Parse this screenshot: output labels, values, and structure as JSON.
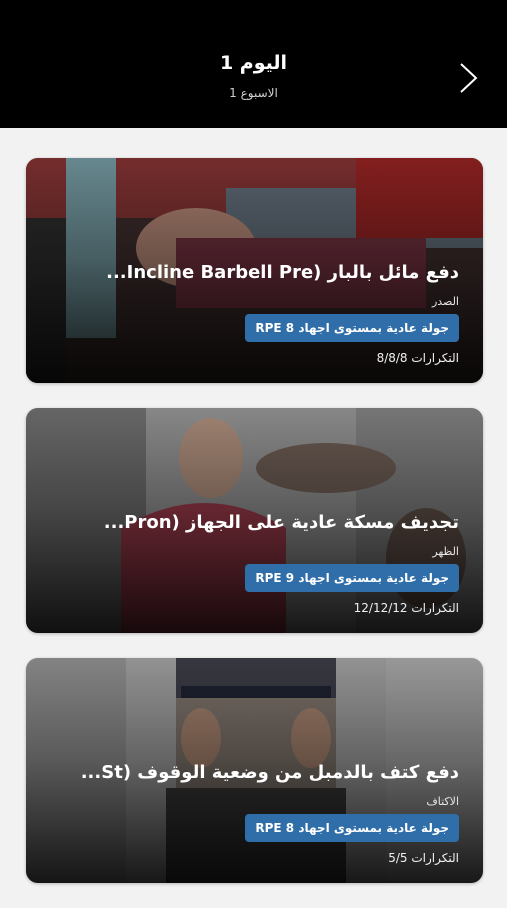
{
  "header": {
    "title": "اليوم 1",
    "subtitle": "الاسبوع 1"
  },
  "workouts": [
    {
      "title": "دفع مائل بالبار (Incline Barbell Pre...",
      "muscle": "الصدر",
      "badge": "جولة عادية بمستوى اجهاد RPE 8",
      "reps": "التكرارات 8/8/8"
    },
    {
      "title": "تجديف مسكة عادية على الجهاز (Pron...",
      "muscle": "الظهر",
      "badge": "جولة عادية بمستوى اجهاد RPE 9",
      "reps": "التكرارات 12/12/12"
    },
    {
      "title": "دفع كتف بالدمبل من وضعية الوقوف (St...",
      "muscle": "الاكتاف",
      "badge": "جولة عادية بمستوى اجهاد RPE 8",
      "reps": "التكرارات 5/5"
    }
  ]
}
